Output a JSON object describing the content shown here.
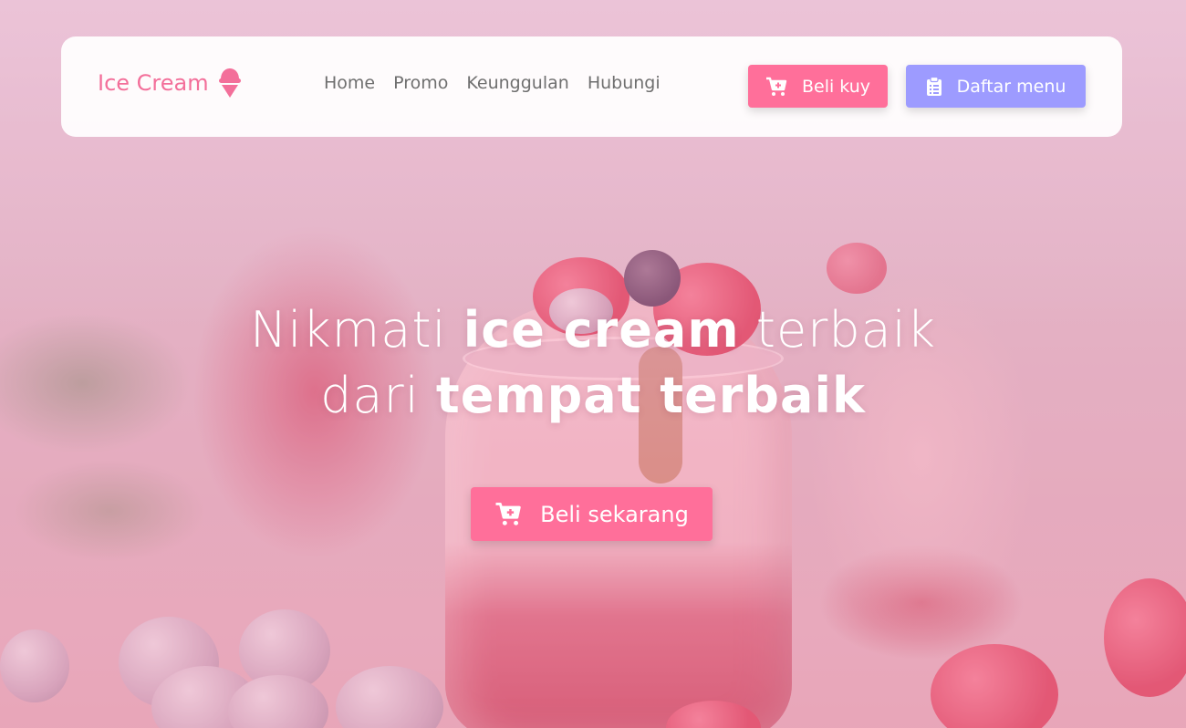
{
  "navbar": {
    "brand": "Ice Cream",
    "brand_icon": "ice-cream-icon",
    "links": [
      "Home",
      "Promo",
      "Keunggulan",
      "Hubungi"
    ],
    "buy_button": "Beli kuy",
    "menu_button": "Daftar menu"
  },
  "hero": {
    "title_part1": "Nikmati ",
    "title_bold1": "ice cream",
    "title_part2": " terbaik",
    "title_part3": "dari ",
    "title_bold2": "tempat terbaik",
    "cta_button": "Beli sekarang"
  },
  "colors": {
    "brand_pink": "#f36f9a",
    "button_pink": "#ff6f9a",
    "button_purple": "#9d9bff"
  }
}
